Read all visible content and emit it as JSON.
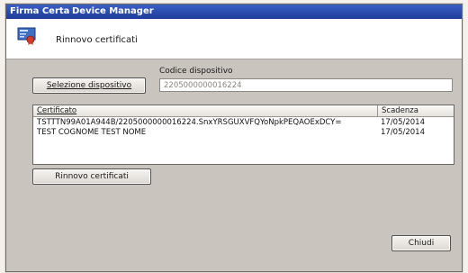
{
  "window": {
    "app_title": "Firma Certa",
    "module_title": "Device Manager"
  },
  "header": {
    "title": "Rinnovo certificati"
  },
  "device": {
    "code_label": "Codice dispositivo",
    "select_button": "Selezione dispositivo",
    "code_value": "2205000000016224"
  },
  "certificates": {
    "columns": [
      "Certificato",
      "Scadenza"
    ],
    "rows": [
      {
        "certificate": "TSTTTN99A01A944B/2205000000016224.SnxYRSGUXVFQYoNpkPEQAOExDCY=",
        "expiry": "17/05/2014"
      },
      {
        "certificate": "TEST COGNOME TEST NOME",
        "expiry": "17/05/2014"
      }
    ]
  },
  "actions": {
    "renew_button": "Rinnovo certificati",
    "close_button": "Chiudi"
  },
  "colors": {
    "titlebar": "#2a4fb8",
    "panel": "#c9c4bd"
  },
  "icons": {
    "header": "certificate-card-icon"
  }
}
